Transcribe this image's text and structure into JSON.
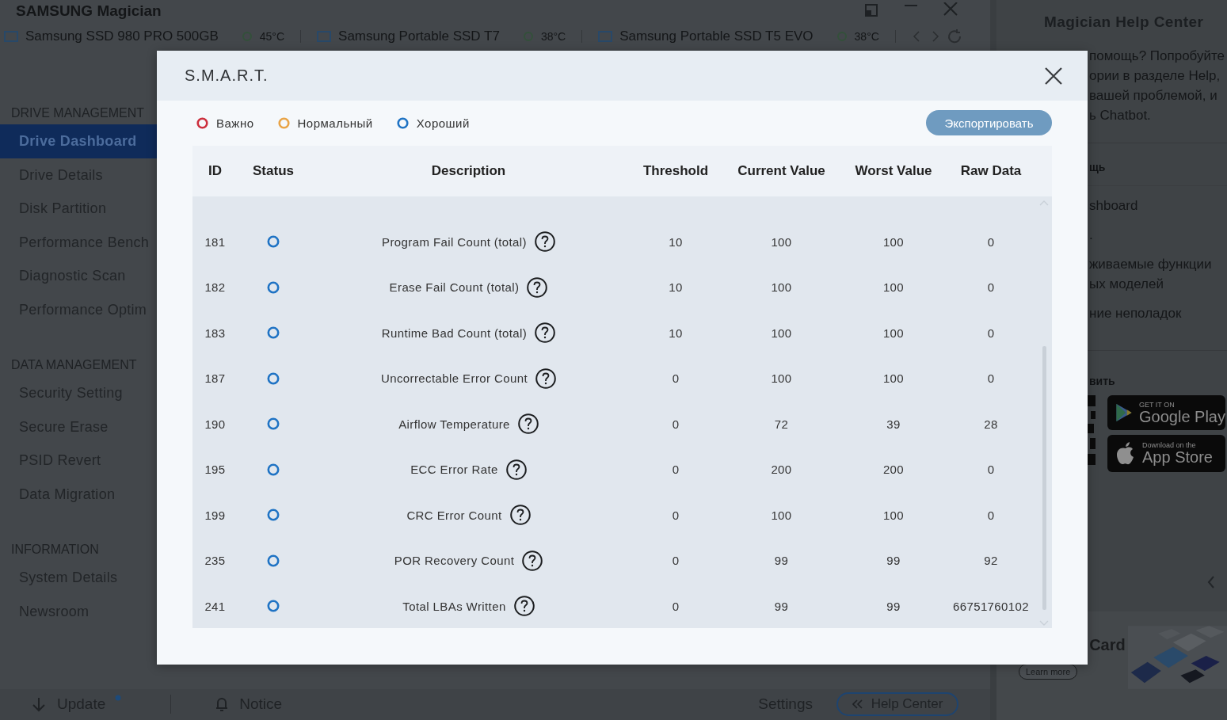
{
  "app": {
    "title": "SAMSUNG Magician"
  },
  "drives": [
    {
      "name": "Samsung SSD 980 PRO 500GB",
      "temperature": "45°C"
    },
    {
      "name": "Samsung Portable SSD T7",
      "temperature": "38°C"
    },
    {
      "name": "Samsung Portable SSD T5 EVO",
      "temperature": "38°C"
    }
  ],
  "sidebar": {
    "sections": [
      {
        "heading": "DRIVE MANAGEMENT",
        "items": [
          {
            "label": "Drive Dashboard",
            "selected": true
          },
          {
            "label": "Drive Details",
            "selected": false
          },
          {
            "label": "Disk Partition",
            "selected": false
          },
          {
            "label": "Performance Bench",
            "selected": false
          },
          {
            "label": "Diagnostic Scan",
            "selected": false
          },
          {
            "label": "Performance Optim",
            "selected": false
          }
        ]
      },
      {
        "heading": "DATA MANAGEMENT",
        "items": [
          {
            "label": "Security Setting",
            "selected": false
          },
          {
            "label": "Secure Erase",
            "selected": false
          },
          {
            "label": "PSID Revert",
            "selected": false
          },
          {
            "label": "Data Migration",
            "selected": false
          }
        ]
      },
      {
        "heading": "INFORMATION",
        "items": [
          {
            "label": "System Details",
            "selected": false
          },
          {
            "label": "Newsroom",
            "selected": false
          }
        ]
      }
    ]
  },
  "bottom_bar": {
    "update": "Update",
    "notice": "Notice",
    "settings": "Settings",
    "help_center": "Help Center"
  },
  "help_panel": {
    "title": "Magician Help Center",
    "intro": [
      "помощь? Попробуйте",
      "ории в разделе Help,",
      "вашей проблемой, и",
      "ь Chatbot."
    ],
    "section_heading": "щь",
    "links": [
      "shboard",
      ".",
      "живаемые функции ых моделей",
      "ние неполадок"
    ],
    "apps_heading": "вить",
    "google_play": {
      "small": "GET IT ON",
      "big": "Google Play"
    },
    "app_store": {
      "small": "Download on the",
      "big": "App Store"
    },
    "banner": {
      "title": "Card",
      "button": "Learn more"
    }
  },
  "modal": {
    "title": "S.M.A.R.T.",
    "legend": [
      {
        "label": "Важно",
        "color": "#cc2f3d"
      },
      {
        "label": "Нормальный",
        "color": "#e9a447"
      },
      {
        "label": "Хороший",
        "color": "#1f73c4"
      }
    ],
    "export_button": "Экспортировать",
    "table": {
      "columns": [
        "ID",
        "Status",
        "Description",
        "Threshold",
        "Current Value",
        "Worst Value",
        "Raw Data"
      ],
      "rows": [
        {
          "id": "181",
          "color": "#1f73c4",
          "description": "Program Fail Count (total)",
          "threshold": "10",
          "current": "100",
          "worst": "100",
          "raw": "0"
        },
        {
          "id": "182",
          "color": "#1f73c4",
          "description": "Erase Fail Count (total)",
          "threshold": "10",
          "current": "100",
          "worst": "100",
          "raw": "0"
        },
        {
          "id": "183",
          "color": "#1f73c4",
          "description": "Runtime Bad Count (total)",
          "threshold": "10",
          "current": "100",
          "worst": "100",
          "raw": "0"
        },
        {
          "id": "187",
          "color": "#1f73c4",
          "description": "Uncorrectable Error Count",
          "threshold": "0",
          "current": "100",
          "worst": "100",
          "raw": "0"
        },
        {
          "id": "190",
          "color": "#1f73c4",
          "description": "Airflow Temperature",
          "threshold": "0",
          "current": "72",
          "worst": "39",
          "raw": "28"
        },
        {
          "id": "195",
          "color": "#1f73c4",
          "description": "ECC Error Rate",
          "threshold": "0",
          "current": "200",
          "worst": "200",
          "raw": "0"
        },
        {
          "id": "199",
          "color": "#1f73c4",
          "description": "CRC Error Count",
          "threshold": "0",
          "current": "100",
          "worst": "100",
          "raw": "0"
        },
        {
          "id": "235",
          "color": "#1f73c4",
          "description": "POR Recovery Count",
          "threshold": "0",
          "current": "99",
          "worst": "99",
          "raw": "92"
        },
        {
          "id": "241",
          "color": "#1f73c4",
          "description": "Total LBAs Written",
          "threshold": "0",
          "current": "99",
          "worst": "99",
          "raw": "66751760102"
        }
      ]
    }
  }
}
